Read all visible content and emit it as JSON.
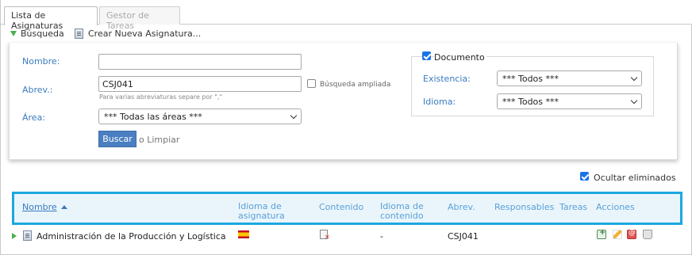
{
  "tabs": [
    {
      "label": "Lista de Asignaturas",
      "active": true
    },
    {
      "label": "Gestor de Tareas",
      "active": false
    }
  ],
  "toolbar": {
    "search_label": "Búsqueda",
    "new_label": "Crear Nueva Asignatura..."
  },
  "search": {
    "name_label": "Nombre:",
    "name_value": "",
    "abbrev_label": "Abrev.:",
    "abbrev_value": "CSJ041",
    "abbrev_hint": "Para varias abreviaturas separe por \",\"",
    "extended_search_label": "Búsqueda ampliada",
    "extended_search_checked": false,
    "area_label": "Área:",
    "area_value": "*** Todas las áreas ***",
    "document_label": "Documento",
    "document_checked": true,
    "existence_label": "Existencia:",
    "existence_value": "*** Todos ***",
    "language_label": "Idioma:",
    "language_value": "*** Todos ***",
    "search_button": "Buscar",
    "or_text": "o",
    "clear_label": "Limpiar"
  },
  "hide_deleted": {
    "label": "Ocultar eliminados",
    "checked": true
  },
  "table": {
    "columns": {
      "name": "Nombre",
      "subject_language_1": "Idioma de",
      "subject_language_2": "asignatura",
      "content": "Contenido",
      "content_language_1": "Idioma de",
      "content_language_2": "contenido",
      "abbrev": "Abrev.",
      "responsible": "Responsables",
      "tasks": "Tareas",
      "actions": "Acciones"
    },
    "rows": [
      {
        "name": "Administración de la Producción y Logística",
        "subject_language": "es",
        "content_language": "-",
        "abbrev": "CSJ041"
      }
    ]
  },
  "colors": {
    "accent": "#3a7abf",
    "highlight_border": "#1ba8e0",
    "button": "#4a7fc1"
  }
}
